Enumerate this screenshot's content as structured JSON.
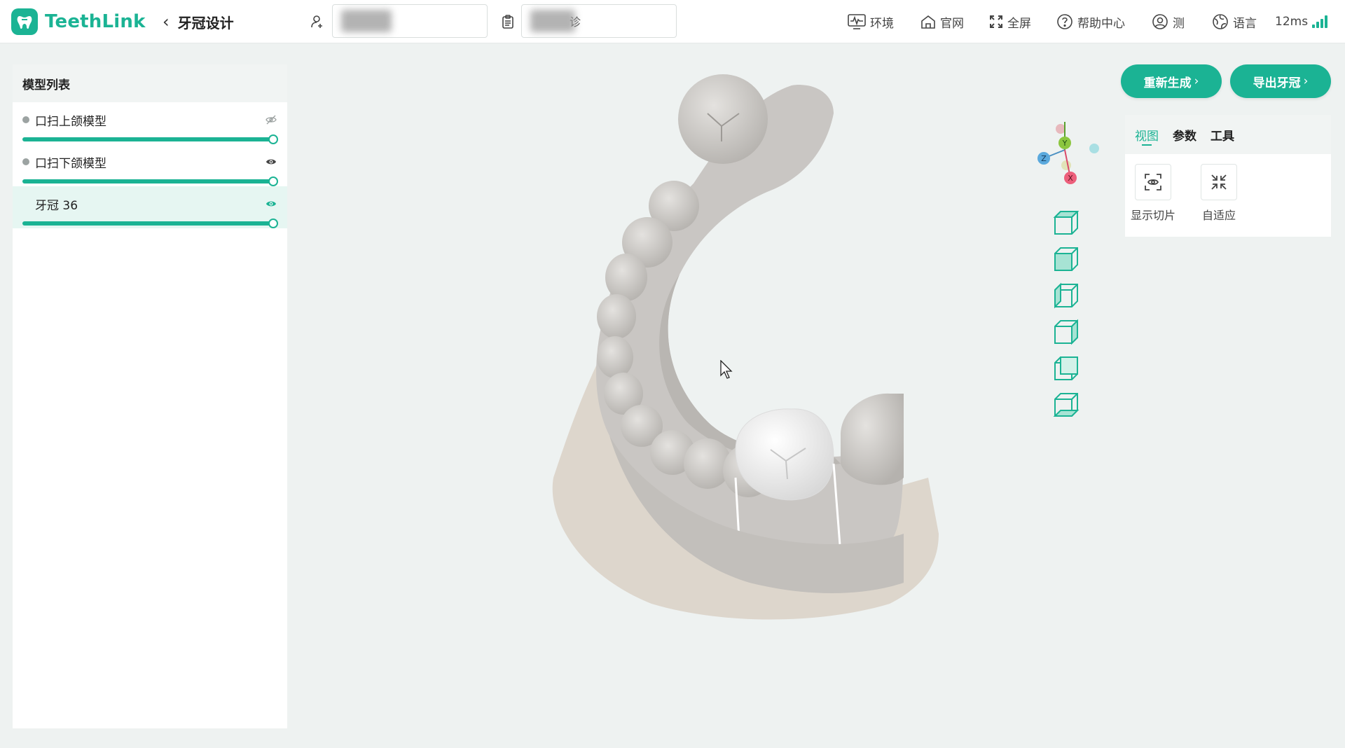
{
  "app": {
    "name": "TeethLink",
    "page_title": "牙冠设计"
  },
  "header": {
    "patient_field": {
      "value": "",
      "icon": "user-add-icon"
    },
    "case_field": {
      "value_suffix": "诊",
      "icon": "clipboard-icon"
    },
    "nav": [
      {
        "label": "环境",
        "icon": "monitor-pulse-icon"
      },
      {
        "label": "官网",
        "icon": "home-icon"
      },
      {
        "label": "全屏",
        "icon": "fullscreen-icon"
      },
      {
        "label": "帮助中心",
        "icon": "help-icon"
      },
      {
        "label": "测",
        "icon": "user-circle-icon"
      },
      {
        "label": "语言",
        "icon": "globe-icon"
      }
    ],
    "latency": "12ms"
  },
  "model_list": {
    "title": "模型列表",
    "items": [
      {
        "label": "口扫上颌模型",
        "visible": false,
        "opacity": 1.0,
        "dot": true
      },
      {
        "label": "口扫下颌模型",
        "visible": true,
        "opacity": 1.0,
        "dot": true
      },
      {
        "label": "牙冠 36",
        "visible": true,
        "opacity": 1.0,
        "dot": false,
        "selected": true
      }
    ]
  },
  "actions": {
    "regenerate": "重新生成",
    "export": "导出牙冠"
  },
  "axes": {
    "x": "X",
    "y": "Y",
    "z": "Z"
  },
  "right_panel": {
    "tabs": [
      "视图",
      "参数",
      "工具"
    ],
    "active_tab": 0,
    "tools": [
      {
        "label": "显示切片",
        "icon": "slice-view-icon"
      },
      {
        "label": "自适应",
        "icon": "fit-view-icon"
      }
    ]
  },
  "colors": {
    "accent": "#1bb394",
    "model": "#c9c6c3",
    "base": "#ddd6cc",
    "crown": "#efefef"
  }
}
